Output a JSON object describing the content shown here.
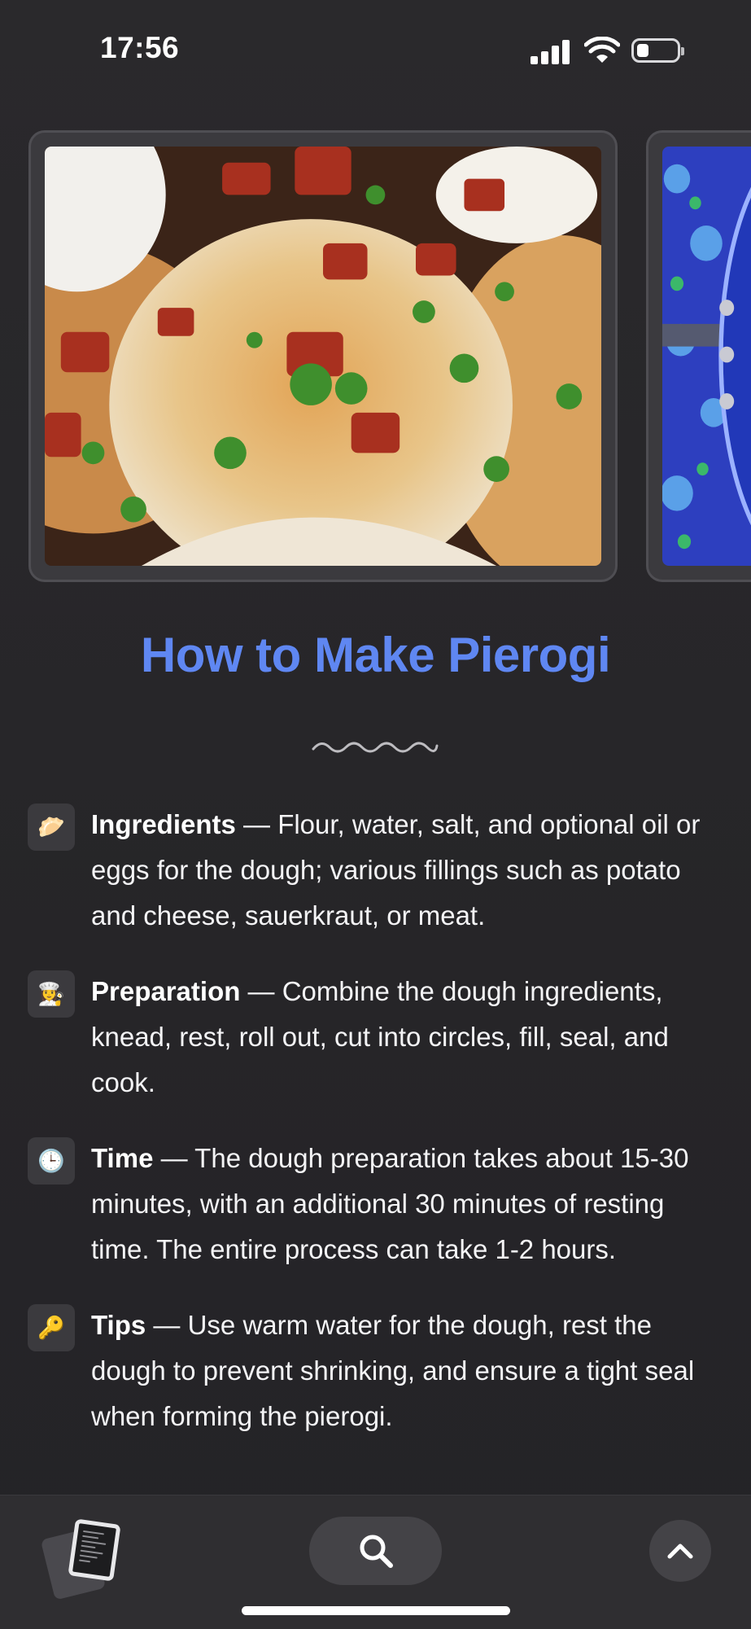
{
  "status_bar": {
    "time": "17:56",
    "signal_icon": "cellular-signal-icon",
    "wifi_icon": "wifi-icon",
    "battery_icon": "battery-icon",
    "battery_level": 0.3
  },
  "carousel": {
    "images": [
      {
        "icon": "pierogi-photo"
      },
      {
        "icon": "blue-floral-pot-photo"
      }
    ]
  },
  "article": {
    "title": "How to Make Pierogi",
    "title_color": "#5f87f2",
    "divider_icon": "wave-divider-icon",
    "items": [
      {
        "icon": "🥟",
        "icon_name": "dumpling-icon",
        "label": "Ingredients",
        "text": " — Flour, water, salt, and optional oil or eggs for the dough; various fillings such as potato and cheese, sauerkraut, or meat."
      },
      {
        "icon": "👩‍🍳",
        "icon_name": "chef-icon",
        "label": "Preparation",
        "text": " — Combine the dough ingredients, knead, rest, roll out, cut into circles, fill, seal, and cook."
      },
      {
        "icon": "🕒",
        "icon_name": "clock-icon",
        "label": "Time",
        "text": " — The dough preparation takes about 15-30 minutes, with an additional 30 minutes of resting time. The entire process can take 1-2 hours."
      },
      {
        "icon": "🔑",
        "icon_name": "key-icon",
        "label": "Tips",
        "text": " — Use warm water for the dough, rest the dough to prevent shrinking, and ensure a tight seal when forming the pierogi."
      }
    ]
  },
  "toolbar": {
    "tabs_icon": "tabs-icon",
    "search_icon": "search-icon",
    "scroll_top_icon": "chevron-up-icon"
  }
}
